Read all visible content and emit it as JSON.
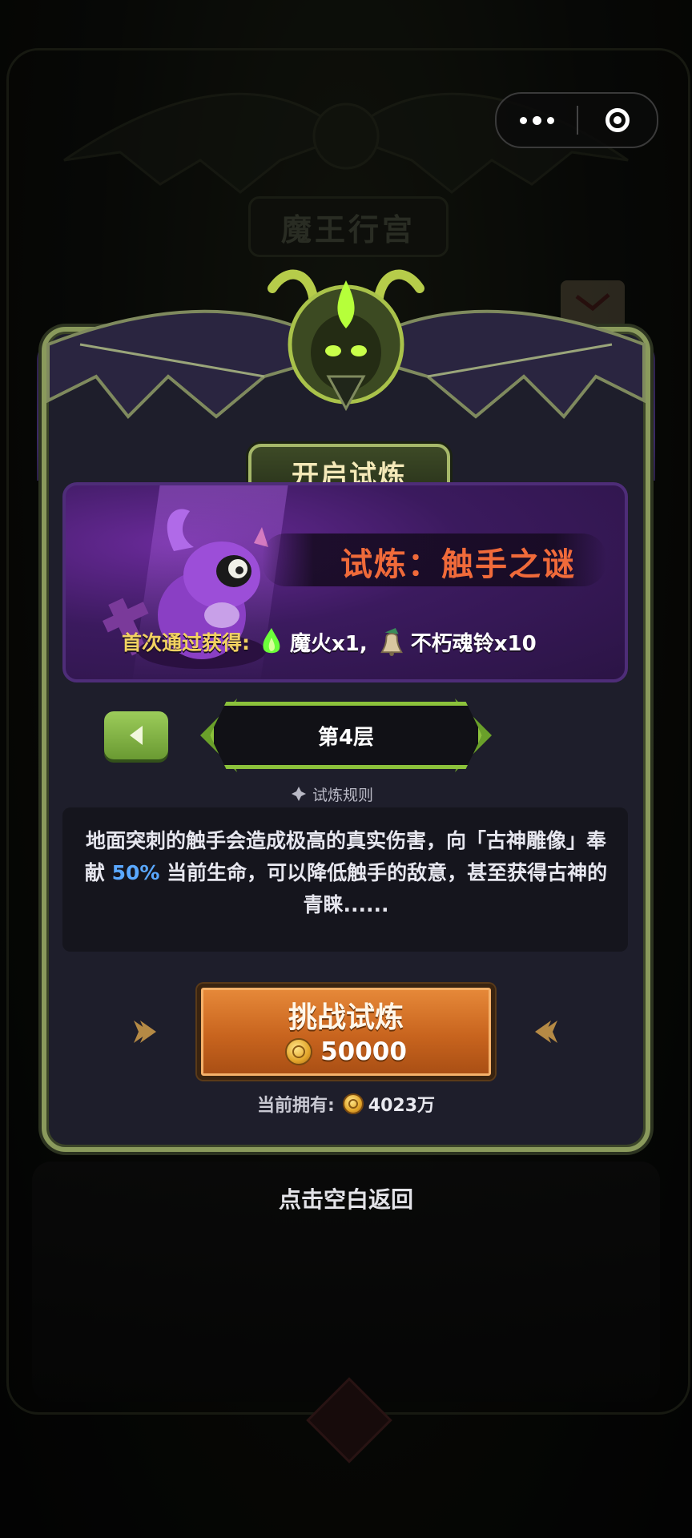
{
  "background": {
    "title": "魔王行宫"
  },
  "capsule": {
    "more_icon": "more-dots-icon",
    "close_icon": "target-close-icon"
  },
  "panel": {
    "tag": "开启试炼",
    "trial_name": "试炼：触手之谜",
    "reward_label": "首次通过获得:",
    "rewards": [
      {
        "icon": "green-flame-icon",
        "text": "魔火x1,"
      },
      {
        "icon": "soul-bell-icon",
        "text": "不朽魂铃x10"
      }
    ],
    "floor": "第4层",
    "rules_title": "试炼规则",
    "rules": {
      "part1": "地面突刺的触手会造成极高的真实伤害，向「古神雕像」奉献 ",
      "highlight": "50%",
      "part2": " 当前生命，可以降低触手的敌意，甚至获得古神的青睐......"
    },
    "challenge": {
      "label": "挑战试炼",
      "cost": "50000"
    },
    "own_label": "当前拥有:",
    "own_value": "4023万"
  },
  "footer": {
    "tap_back": "点击空白返回"
  },
  "colors": {
    "accent_green": "#8cc23b",
    "trial_name": "#f06a3a",
    "reward_label": "#f2d261",
    "highlight": "#5aa8ff",
    "button_orange": "#c8641e"
  }
}
